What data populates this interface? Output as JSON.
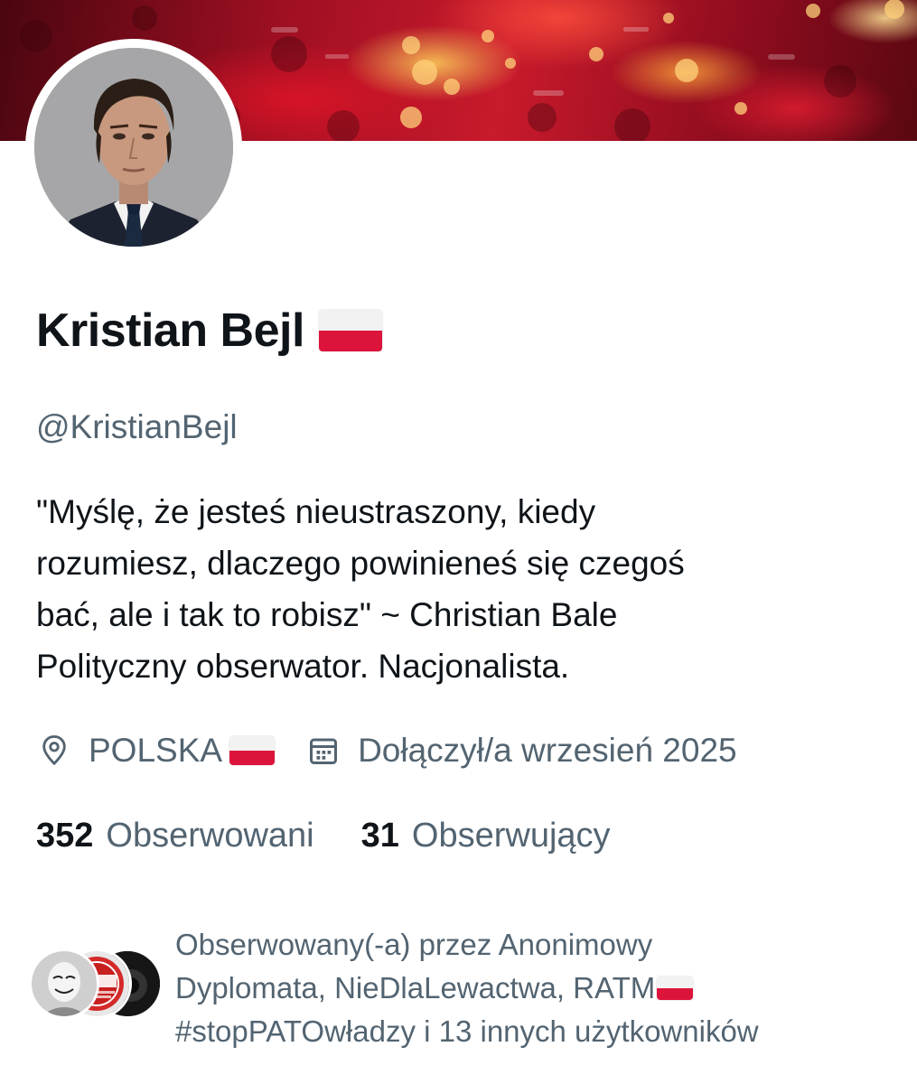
{
  "profile": {
    "display_name": "Kristian Bejl",
    "handle": "@KristianBejl",
    "bio_lines": [
      "\"Myślę, że jesteś nieustraszony, kiedy",
      "rozumiesz, dlaczego powinieneś się czegoś",
      "bać, ale i tak to robisz\" ~ Christian Bale",
      "Polityczny obserwator. Nacjonalista."
    ],
    "location": "POLSKA",
    "joined": "Dołączył/a wrzesień 2025"
  },
  "stats": {
    "following_count": "352",
    "following_label": "Obserwowani",
    "followers_count": "31",
    "followers_label": "Obserwujący"
  },
  "followed_by": {
    "lines": [
      "Obserwowany(-a) przez Anonimowy",
      "Dyplomata, NieDlaLewactwa, RATM",
      "#stopPATOwładzy i 13 innych użytkowników"
    ]
  },
  "icons": [
    "location-pin-icon",
    "calendar-icon",
    "poland-flag-icon"
  ],
  "colors": {
    "text_primary": "#0f1419",
    "text_secondary": "#536471",
    "flag_white": "#f2f2f2",
    "flag_red": "#dc143c"
  }
}
